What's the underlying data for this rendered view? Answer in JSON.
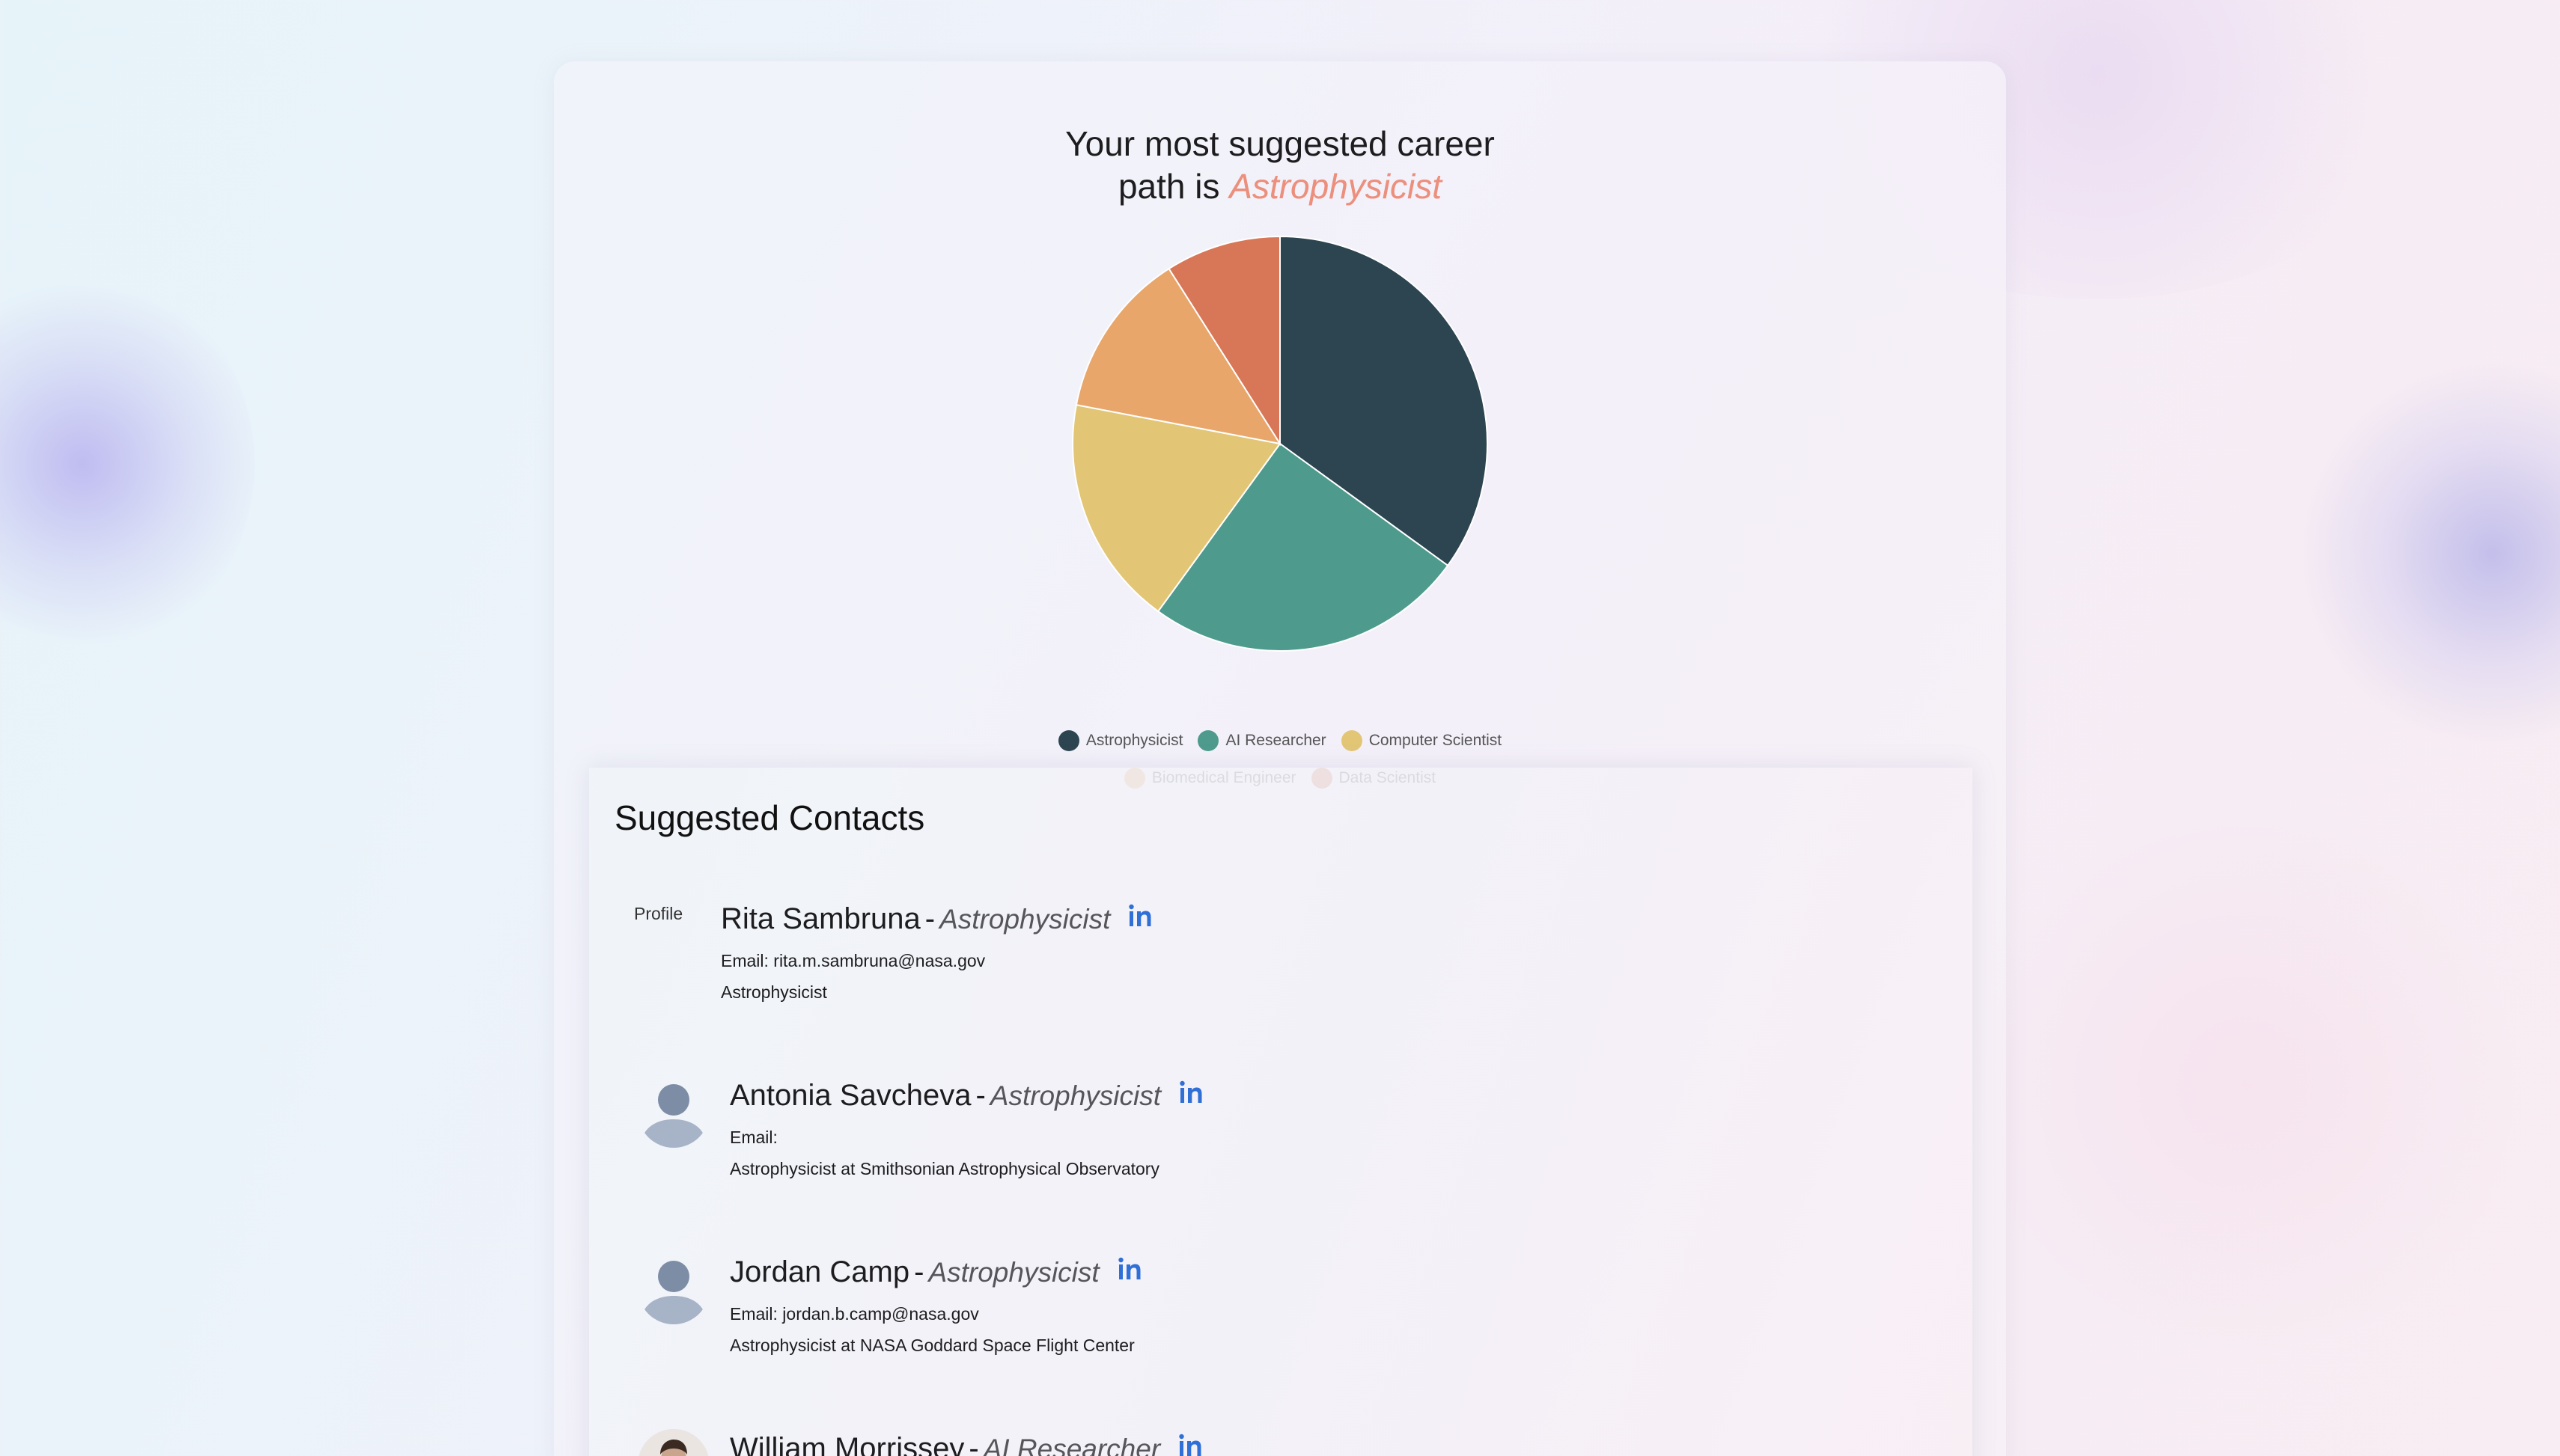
{
  "career": {
    "title_prefix": "Your most suggested career",
    "title_line2": "path is",
    "top_path": "Astrophysicist"
  },
  "chart_data": {
    "type": "pie",
    "categories": [
      "Astrophysicist",
      "AI Researcher",
      "Computer Scientist",
      "Biomedical Engineer",
      "Data Scientist"
    ],
    "values": [
      35,
      25,
      18,
      13,
      9
    ],
    "colors": [
      "#2d4550",
      "#4e9b8d",
      "#e2c676",
      "#e8a66b",
      "#d87757"
    ],
    "legend_position": "bottom"
  },
  "contacts": {
    "heading": "Suggested Contacts",
    "items": [
      {
        "image": "broken",
        "image_alt": "Profile",
        "name": "Rita Sambruna",
        "sep": "-",
        "role": "Astrophysicist",
        "email": "Email: rita.m.sambruna@nasa.gov",
        "desc": "Astrophysicist",
        "linkedin_icon": "linkedin-icon"
      },
      {
        "image": "placeholder",
        "name": "Antonia Savcheva",
        "sep": "-",
        "role": "Astrophysicist",
        "email": "Email:",
        "desc": "Astrophysicist at Smithsonian Astrophysical Observatory",
        "linkedin_icon": "linkedin-icon"
      },
      {
        "image": "placeholder",
        "name": "Jordan Camp",
        "sep": "-",
        "role": "Astrophysicist",
        "email": "Email: jordan.b.camp@nasa.gov",
        "desc": "Astrophysicist at NASA Goddard Space Flight Center",
        "linkedin_icon": "linkedin-icon"
      },
      {
        "image": "photo",
        "name": "William Morrissey",
        "sep": "-",
        "role": "AI Researcher",
        "linkedin_icon": "linkedin-icon"
      }
    ]
  }
}
